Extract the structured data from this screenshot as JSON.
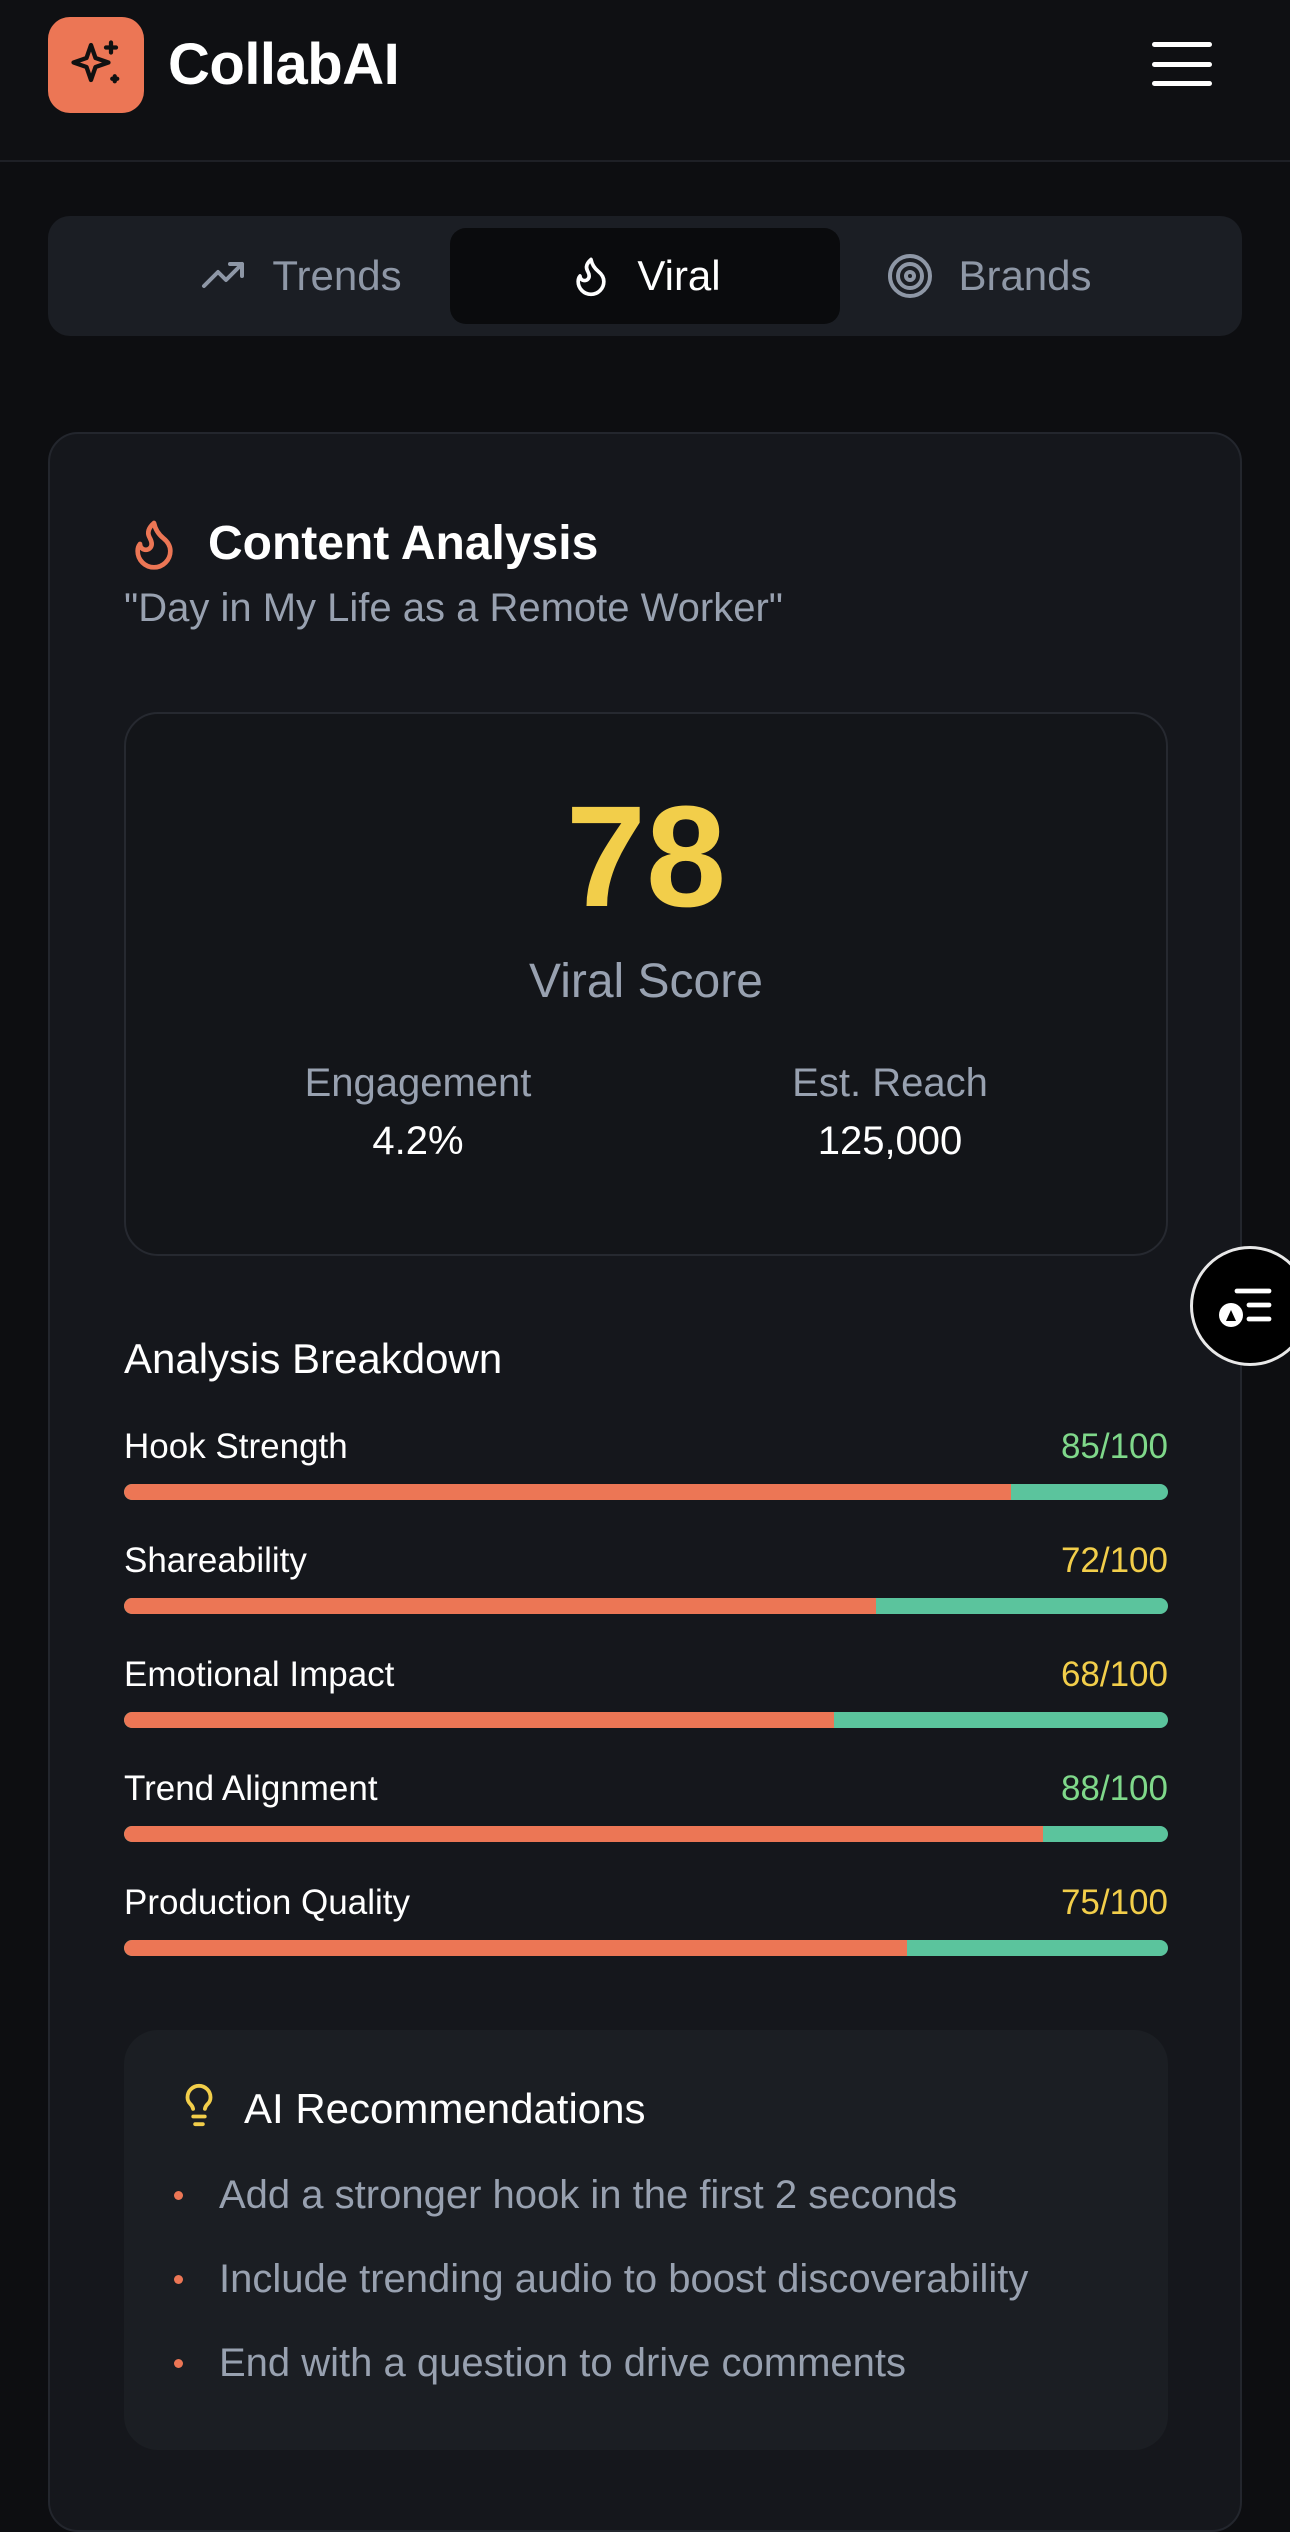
{
  "header": {
    "app_title": "CollabAI",
    "logo_icon": "sparkle-icon",
    "menu_icon": "hamburger-menu-icon"
  },
  "tabs": [
    {
      "label": "Trends",
      "icon": "trending-up-icon",
      "active": false
    },
    {
      "label": "Viral",
      "icon": "flame-icon",
      "active": true
    },
    {
      "label": "Brands",
      "icon": "target-icon",
      "active": false
    }
  ],
  "analysis": {
    "title": "Content Analysis",
    "subtitle": "\"Day in My Life as a Remote Worker\"",
    "viral_score": "78",
    "viral_score_label": "Viral Score",
    "engagement_label": "Engagement",
    "engagement_value": "4.2%",
    "reach_label": "Est. Reach",
    "reach_value": "125,000"
  },
  "breakdown": {
    "title": "Analysis Breakdown",
    "metrics": [
      {
        "name": "Hook Strength",
        "score": "85/100",
        "value": 85,
        "score_color": "#7fd88a"
      },
      {
        "name": "Shareability",
        "score": "72/100",
        "value": 72,
        "score_color": "#f2ce4a"
      },
      {
        "name": "Emotional Impact",
        "score": "68/100",
        "value": 68,
        "score_color": "#f2ce4a"
      },
      {
        "name": "Trend Alignment",
        "score": "88/100",
        "value": 88,
        "score_color": "#7fd88a"
      },
      {
        "name": "Production Quality",
        "score": "75/100",
        "value": 75,
        "score_color": "#f2ce4a"
      }
    ]
  },
  "recommendations": {
    "title": "AI Recommendations",
    "icon": "lightbulb-icon",
    "items": [
      "Add a stronger hook in the first 2 seconds",
      "Include trending audio to boost discoverability",
      "End with a question to drive comments"
    ]
  },
  "colors": {
    "accent": "#ec7655",
    "score_yellow": "#f2ce4a",
    "bar_track": "#5bc49d",
    "good_green": "#7fd88a"
  },
  "floating_button_icon": "accessibility-menu-icon"
}
